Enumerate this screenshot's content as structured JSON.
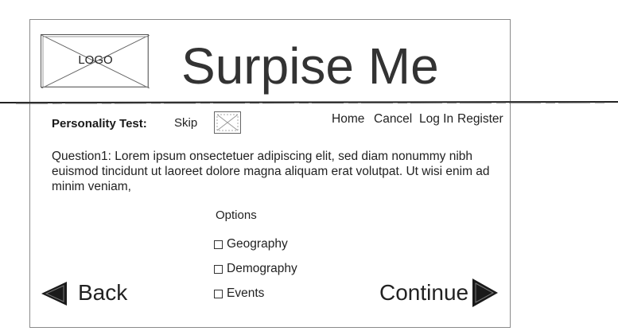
{
  "header": {
    "logo_label": "LOGO",
    "title": "Surpise Me"
  },
  "toolbar": {
    "section_label": "Personality Test:",
    "skip_label": "Skip",
    "nav": [
      "Home",
      "Cancel",
      "Log In",
      "Register"
    ]
  },
  "question": {
    "text": "Question1: Lorem ipsum onsectetuer adipiscing elit, sed diam nonummy nibh euismod tincidunt ut laoreet dolore magna aliquam erat volutpat. Ut wisi enim ad minim veniam,"
  },
  "options": {
    "label": "Options",
    "items": [
      "Geography",
      "Demography",
      "Events"
    ]
  },
  "footer": {
    "back_label": "Back",
    "continue_label": "Continue"
  }
}
